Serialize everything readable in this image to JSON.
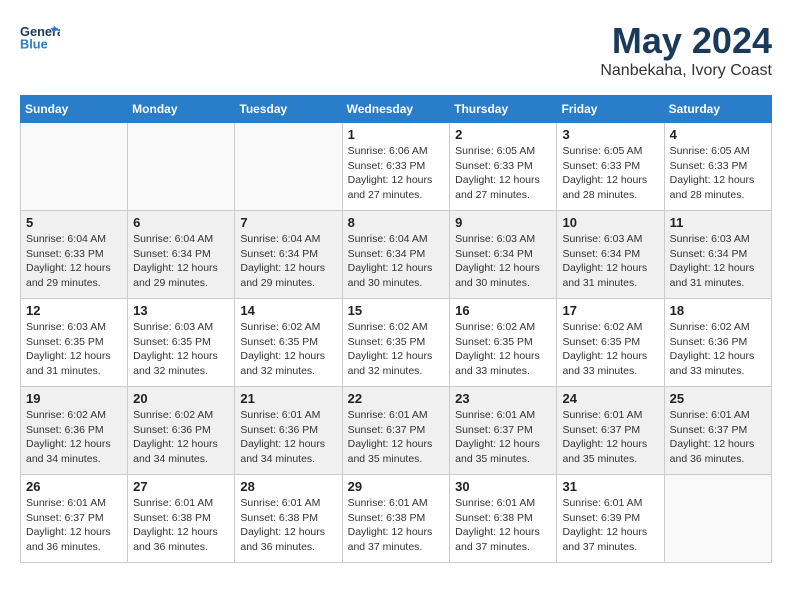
{
  "header": {
    "logo_line1": "General",
    "logo_line2": "Blue",
    "month": "May 2024",
    "location": "Nanbekaha, Ivory Coast"
  },
  "weekdays": [
    "Sunday",
    "Monday",
    "Tuesday",
    "Wednesday",
    "Thursday",
    "Friday",
    "Saturday"
  ],
  "weeks": [
    [
      {
        "day": "",
        "info": ""
      },
      {
        "day": "",
        "info": ""
      },
      {
        "day": "",
        "info": ""
      },
      {
        "day": "1",
        "info": "Sunrise: 6:06 AM\nSunset: 6:33 PM\nDaylight: 12 hours\nand 27 minutes."
      },
      {
        "day": "2",
        "info": "Sunrise: 6:05 AM\nSunset: 6:33 PM\nDaylight: 12 hours\nand 27 minutes."
      },
      {
        "day": "3",
        "info": "Sunrise: 6:05 AM\nSunset: 6:33 PM\nDaylight: 12 hours\nand 28 minutes."
      },
      {
        "day": "4",
        "info": "Sunrise: 6:05 AM\nSunset: 6:33 PM\nDaylight: 12 hours\nand 28 minutes."
      }
    ],
    [
      {
        "day": "5",
        "info": "Sunrise: 6:04 AM\nSunset: 6:33 PM\nDaylight: 12 hours\nand 29 minutes."
      },
      {
        "day": "6",
        "info": "Sunrise: 6:04 AM\nSunset: 6:34 PM\nDaylight: 12 hours\nand 29 minutes."
      },
      {
        "day": "7",
        "info": "Sunrise: 6:04 AM\nSunset: 6:34 PM\nDaylight: 12 hours\nand 29 minutes."
      },
      {
        "day": "8",
        "info": "Sunrise: 6:04 AM\nSunset: 6:34 PM\nDaylight: 12 hours\nand 30 minutes."
      },
      {
        "day": "9",
        "info": "Sunrise: 6:03 AM\nSunset: 6:34 PM\nDaylight: 12 hours\nand 30 minutes."
      },
      {
        "day": "10",
        "info": "Sunrise: 6:03 AM\nSunset: 6:34 PM\nDaylight: 12 hours\nand 31 minutes."
      },
      {
        "day": "11",
        "info": "Sunrise: 6:03 AM\nSunset: 6:34 PM\nDaylight: 12 hours\nand 31 minutes."
      }
    ],
    [
      {
        "day": "12",
        "info": "Sunrise: 6:03 AM\nSunset: 6:35 PM\nDaylight: 12 hours\nand 31 minutes."
      },
      {
        "day": "13",
        "info": "Sunrise: 6:03 AM\nSunset: 6:35 PM\nDaylight: 12 hours\nand 32 minutes."
      },
      {
        "day": "14",
        "info": "Sunrise: 6:02 AM\nSunset: 6:35 PM\nDaylight: 12 hours\nand 32 minutes."
      },
      {
        "day": "15",
        "info": "Sunrise: 6:02 AM\nSunset: 6:35 PM\nDaylight: 12 hours\nand 32 minutes."
      },
      {
        "day": "16",
        "info": "Sunrise: 6:02 AM\nSunset: 6:35 PM\nDaylight: 12 hours\nand 33 minutes."
      },
      {
        "day": "17",
        "info": "Sunrise: 6:02 AM\nSunset: 6:35 PM\nDaylight: 12 hours\nand 33 minutes."
      },
      {
        "day": "18",
        "info": "Sunrise: 6:02 AM\nSunset: 6:36 PM\nDaylight: 12 hours\nand 33 minutes."
      }
    ],
    [
      {
        "day": "19",
        "info": "Sunrise: 6:02 AM\nSunset: 6:36 PM\nDaylight: 12 hours\nand 34 minutes."
      },
      {
        "day": "20",
        "info": "Sunrise: 6:02 AM\nSunset: 6:36 PM\nDaylight: 12 hours\nand 34 minutes."
      },
      {
        "day": "21",
        "info": "Sunrise: 6:01 AM\nSunset: 6:36 PM\nDaylight: 12 hours\nand 34 minutes."
      },
      {
        "day": "22",
        "info": "Sunrise: 6:01 AM\nSunset: 6:37 PM\nDaylight: 12 hours\nand 35 minutes."
      },
      {
        "day": "23",
        "info": "Sunrise: 6:01 AM\nSunset: 6:37 PM\nDaylight: 12 hours\nand 35 minutes."
      },
      {
        "day": "24",
        "info": "Sunrise: 6:01 AM\nSunset: 6:37 PM\nDaylight: 12 hours\nand 35 minutes."
      },
      {
        "day": "25",
        "info": "Sunrise: 6:01 AM\nSunset: 6:37 PM\nDaylight: 12 hours\nand 36 minutes."
      }
    ],
    [
      {
        "day": "26",
        "info": "Sunrise: 6:01 AM\nSunset: 6:37 PM\nDaylight: 12 hours\nand 36 minutes."
      },
      {
        "day": "27",
        "info": "Sunrise: 6:01 AM\nSunset: 6:38 PM\nDaylight: 12 hours\nand 36 minutes."
      },
      {
        "day": "28",
        "info": "Sunrise: 6:01 AM\nSunset: 6:38 PM\nDaylight: 12 hours\nand 36 minutes."
      },
      {
        "day": "29",
        "info": "Sunrise: 6:01 AM\nSunset: 6:38 PM\nDaylight: 12 hours\nand 37 minutes."
      },
      {
        "day": "30",
        "info": "Sunrise: 6:01 AM\nSunset: 6:38 PM\nDaylight: 12 hours\nand 37 minutes."
      },
      {
        "day": "31",
        "info": "Sunrise: 6:01 AM\nSunset: 6:39 PM\nDaylight: 12 hours\nand 37 minutes."
      },
      {
        "day": "",
        "info": ""
      }
    ]
  ]
}
